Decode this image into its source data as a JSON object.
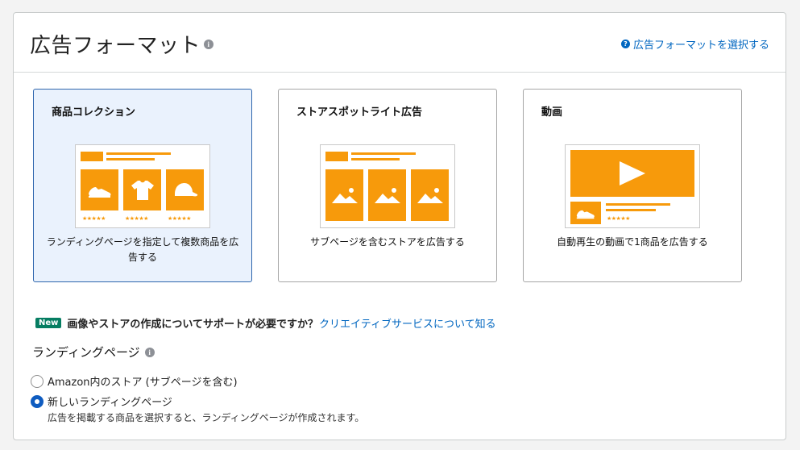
{
  "header": {
    "title": "広告フォーマット",
    "help_link": "広告フォーマットを選択する"
  },
  "cards": [
    {
      "title": "商品コレクション",
      "description": "ランディングページを指定して複数商品を広告する",
      "selected": true
    },
    {
      "title": "ストアスポットライト広告",
      "description": "サブページを含むストアを広告する",
      "selected": false
    },
    {
      "title": "動画",
      "description": "自動再生の動画で1商品を広告する",
      "selected": false
    }
  ],
  "creative_help": {
    "badge": "New",
    "text": "画像やストアの作成についてサポートが必要ですか？",
    "link": "クリエイティブサービスについて知る"
  },
  "landing_page": {
    "title": "ランディングページ",
    "options": [
      {
        "label": "Amazon内のストア (サブページを含む)",
        "checked": false
      },
      {
        "label": "新しいランディングページ",
        "checked": true
      }
    ],
    "note": "広告を掲載する商品を選択すると、ランディングページが作成されます。"
  },
  "colors": {
    "accent_orange": "#f79a0b",
    "selected_bg": "#eaf2fd",
    "selected_border": "#2f66ad",
    "link": "#0066c0",
    "new_badge": "#067d62"
  }
}
